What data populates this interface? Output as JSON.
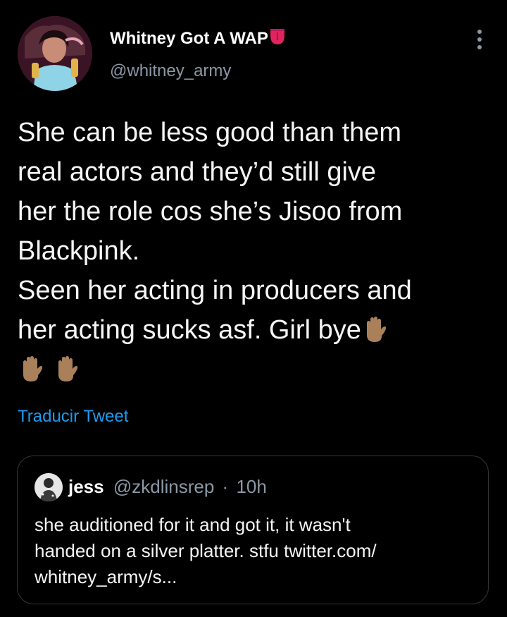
{
  "author": {
    "display_name": "Whitney Got A WAP",
    "emoji_icon": "tongue-emoji",
    "handle": "@whitney_army"
  },
  "tweet": {
    "lines": [
      "She can be less good than them",
      "real actors and they’d still give",
      "her the role cos she’s Jisoo from",
      "Blackpink.",
      "Seen her acting in producers and",
      "her acting sucks asf. Girl bye"
    ],
    "trailing_emoji": "raised-hand-emoji",
    "extra_emoji_count": 2
  },
  "translate_label": "Traducir Tweet",
  "quoted": {
    "name": "jess",
    "handle": "@zkdlinsrep",
    "separator": "·",
    "time": "10h",
    "lines": [
      "she auditioned for it and got it, it wasn't",
      "handed on a silver platter. stfu twitter.com/",
      "whitney_army/s..."
    ]
  },
  "colors": {
    "background": "#000000",
    "link": "#1d9bf0",
    "secondary_text": "#8b98a5",
    "border": "#333639",
    "emoji_skin": "#a9805a"
  }
}
